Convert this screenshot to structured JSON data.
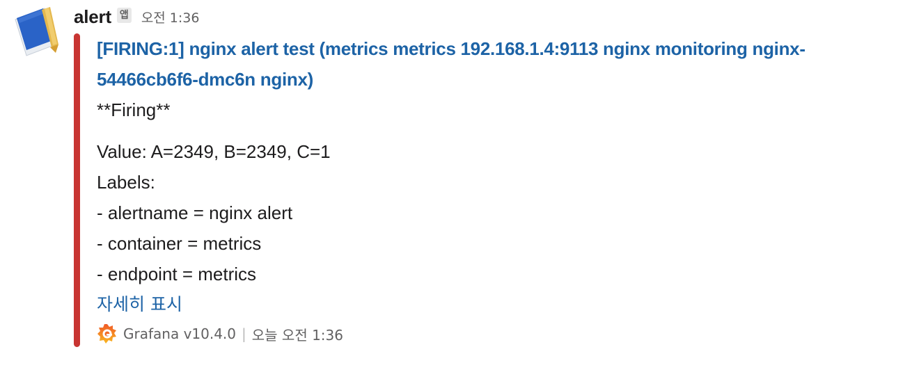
{
  "message": {
    "sender": "alert",
    "app_badge": "앱",
    "timestamp": "오전 1:36",
    "avatar_icon": "notebook-icon"
  },
  "attachment": {
    "color": "#c83532",
    "title": "[FIRING:1] nginx alert test (metrics metrics 192.168.1.4:9113 nginx monitoring nginx-54466cb6f6-dmc6n nginx)",
    "status_line": "**Firing**",
    "lines": [
      "Value: A=2349, B=2349, C=1",
      "Labels:",
      "- alertname = nginx alert",
      "- container = metrics",
      "- endpoint = metrics"
    ],
    "show_more": "자세히 표시",
    "footer": {
      "icon": "grafana-icon",
      "text": "Grafana v10.4.0",
      "separator": "|",
      "time": "오늘 오전 1:36"
    }
  },
  "colors": {
    "link": "#1d63a6",
    "text": "#1d1c1d",
    "muted": "#616061",
    "bar": "#c83532"
  }
}
